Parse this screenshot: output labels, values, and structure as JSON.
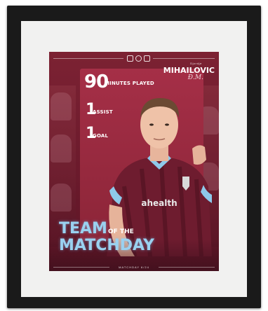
{
  "poster": {
    "stats": [
      {
        "value": "90",
        "label": "MINUTES PLAYED"
      },
      {
        "value": "1",
        "label": "ASSIST"
      },
      {
        "value": "1",
        "label": "GOAL"
      }
    ],
    "player_first_name": "Djordje",
    "player_last_name": "MIHAILOVIC",
    "signature": "Đ.M.",
    "headline_1": "TEAM",
    "headline_connector": "OF THE",
    "headline_2": "MATCHDAY",
    "footer": "MATCHDAY 6/24",
    "jersey_text": "ahealth",
    "colors": {
      "frame": "#1a1a1a",
      "mat": "#f1f1f0",
      "poster_bg": "#7c2233",
      "panel": "#a52f47",
      "headline": "#9ad1f0"
    }
  }
}
